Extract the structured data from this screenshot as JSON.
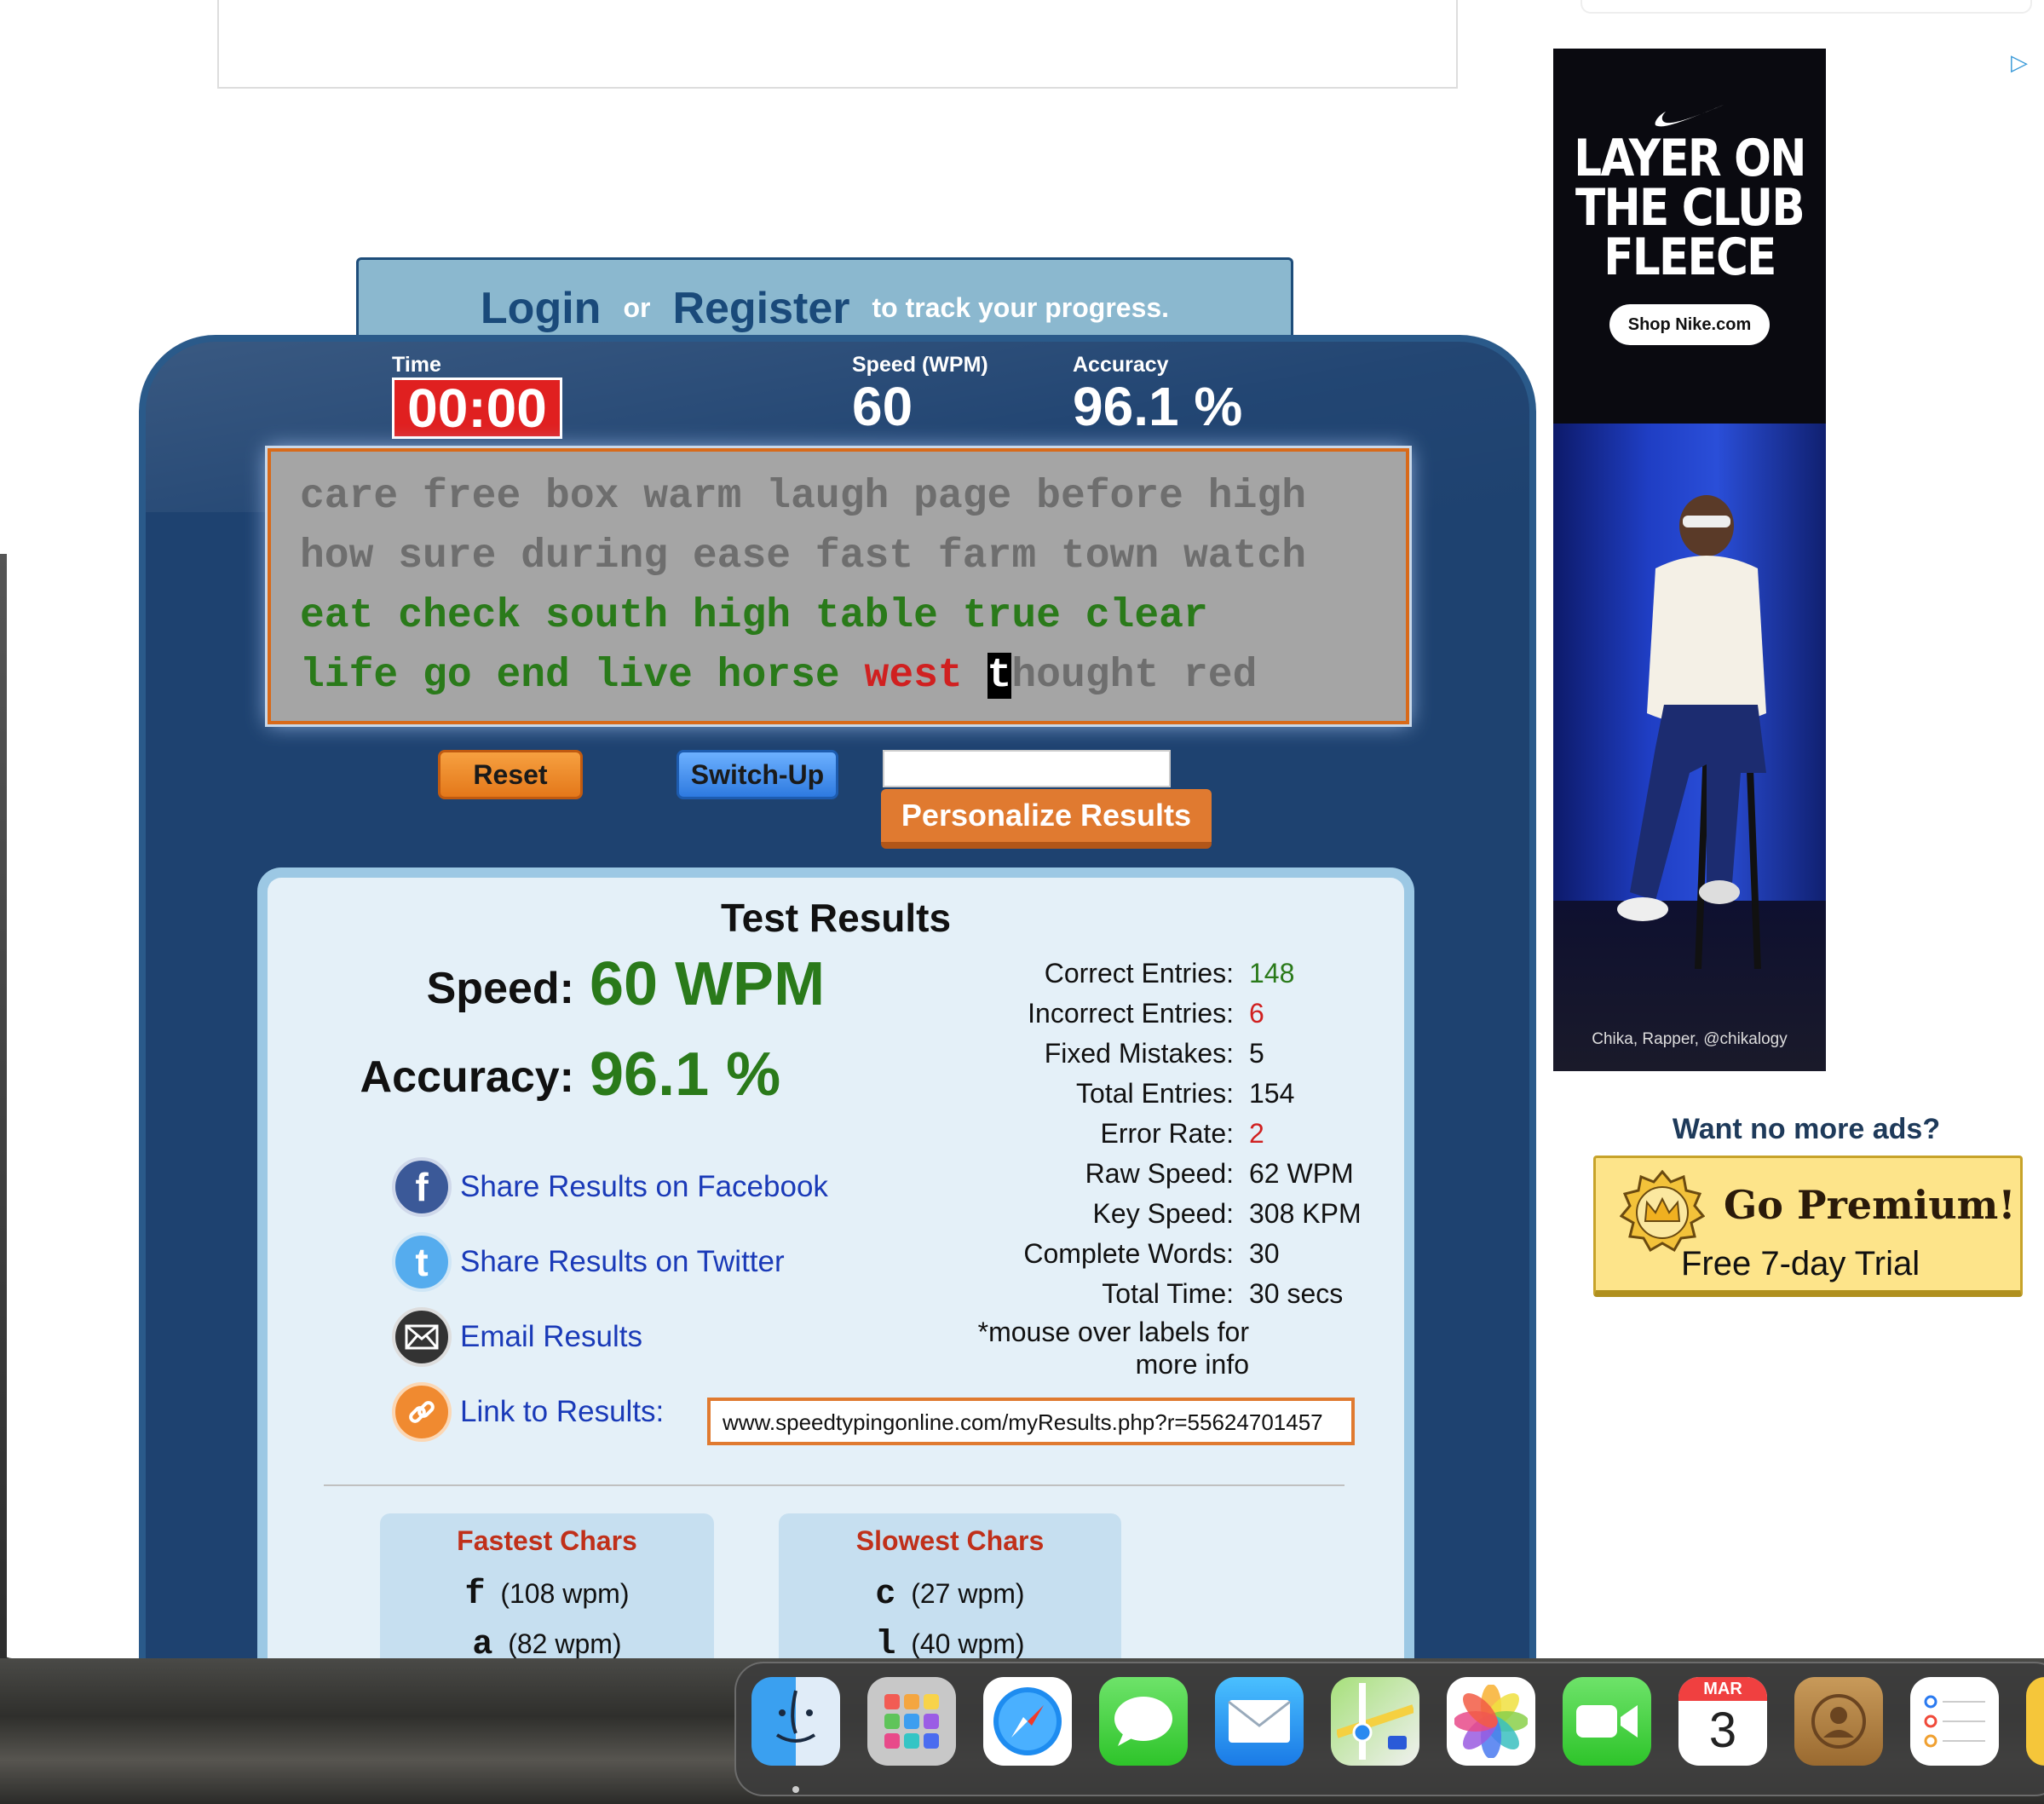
{
  "login_bar": {
    "login": "Login",
    "or": "or",
    "register": "Register",
    "suffix": "to track your progress."
  },
  "stats": {
    "time_label": "Time",
    "time_value": "00:00",
    "speed_label": "Speed (WPM)",
    "speed_value": "60",
    "accuracy_label": "Accuracy",
    "accuracy_value": "96.1 %"
  },
  "typing": {
    "line1": "care free box warm laugh page before high",
    "line2": "how sure during ease fast farm town watch",
    "line3": "eat check south high table true clear",
    "line4_correct": "life go end live horse ",
    "line4_wrong": "west",
    "line4_space": " ",
    "line4_cursor": "t",
    "line4_rest": "hought red"
  },
  "buttons": {
    "reset": "Reset",
    "switch_up": "Switch-Up",
    "personalize": "Personalize Results",
    "name_value": ""
  },
  "results": {
    "title": "Test Results",
    "speed_label": "Speed:",
    "speed_value": "60 WPM",
    "accuracy_label": "Accuracy:",
    "accuracy_value": "96.1 %",
    "details": [
      {
        "label": "Correct Entries:",
        "value": "148"
      },
      {
        "label": "Incorrect Entries:",
        "value": "6"
      },
      {
        "label": "Fixed Mistakes:",
        "value": "5"
      },
      {
        "label": "Total Entries:",
        "value": "154"
      },
      {
        "label": "Error Rate:",
        "value": "2"
      },
      {
        "label": "Raw Speed:",
        "value": "62 WPM"
      },
      {
        "label": "Key Speed:",
        "value": "308 KPM"
      },
      {
        "label": "Complete Words:",
        "value": "30"
      },
      {
        "label": "Total Time:",
        "value": "30 secs"
      }
    ],
    "mouse_note_1": "*mouse over labels for",
    "mouse_note_2": "more info",
    "share_facebook": "Share Results on Facebook",
    "share_twitter": "Share Results on Twitter",
    "email": "Email Results",
    "link_label": "Link to Results:",
    "link_value": "www.speedtypingonline.com/myResults.php?r=55624701457",
    "fastest_title": "Fastest Chars",
    "fastest": [
      {
        "ch": "f",
        "wpm": "(108 wpm)"
      },
      {
        "ch": "a",
        "wpm": "(82 wpm)"
      }
    ],
    "slowest_title": "Slowest Chars",
    "slowest": [
      {
        "ch": "c",
        "wpm": "(27 wpm)"
      },
      {
        "ch": "l",
        "wpm": "(40 wpm)"
      }
    ]
  },
  "ad": {
    "headline_1": "LAYER ON",
    "headline_2": "THE CLUB",
    "headline_3": "FLEECE",
    "cta": "Shop Nike.com",
    "caption": "Chika, Rapper, @chikalogy"
  },
  "premium": {
    "prompt": "Want no more ads?",
    "title": "Go Premium!",
    "subtitle": "Free 7-day Trial"
  },
  "dock": {
    "calendar_month": "MAR",
    "calendar_day": "3"
  },
  "colors": {
    "correct": "#2a7a1a",
    "wrong": "#d02020",
    "panel": "#1e4270",
    "accent": "#e07a30"
  }
}
